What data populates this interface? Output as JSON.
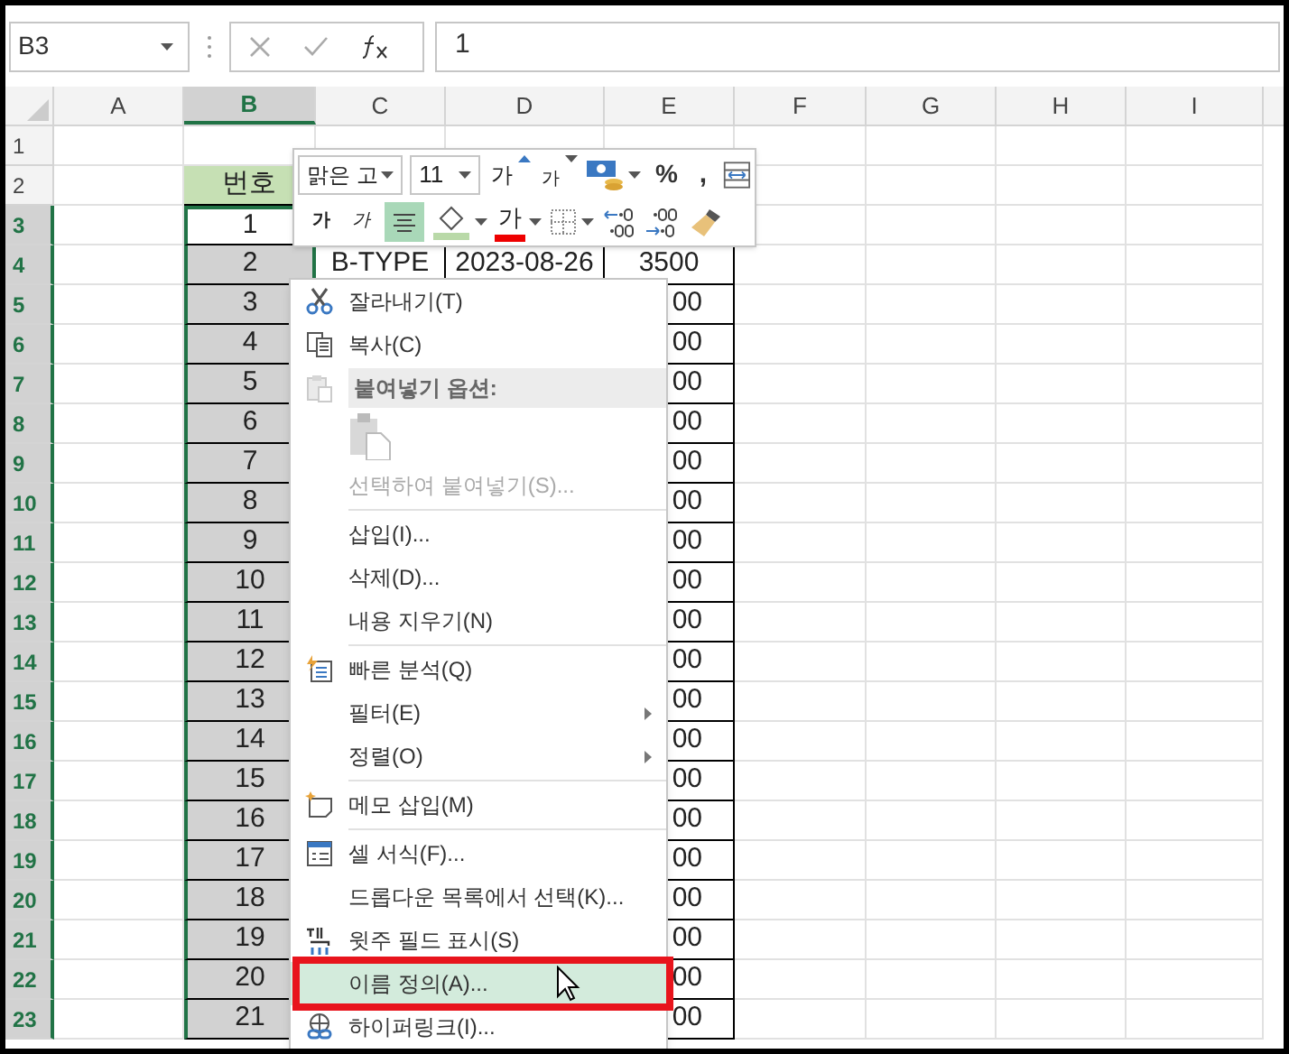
{
  "name_box": {
    "value": "B3"
  },
  "formula_bar": {
    "value": "1"
  },
  "columns": [
    {
      "label": "A",
      "selected": false
    },
    {
      "label": "B",
      "selected": true
    },
    {
      "label": "C",
      "selected": false
    },
    {
      "label": "D",
      "selected": false
    },
    {
      "label": "E",
      "selected": false
    },
    {
      "label": "F",
      "selected": false
    },
    {
      "label": "G",
      "selected": false
    },
    {
      "label": "H",
      "selected": false
    },
    {
      "label": "I",
      "selected": false
    }
  ],
  "rows": [
    {
      "label": "1",
      "selected": false,
      "active": false,
      "kind": "plain",
      "cells": {}
    },
    {
      "label": "2",
      "selected": false,
      "active": false,
      "kind": "header",
      "cells": {
        "B": "번호"
      }
    },
    {
      "label": "3",
      "selected": true,
      "active": true,
      "kind": "data",
      "cells": {
        "B": "1"
      }
    },
    {
      "label": "4",
      "selected": true,
      "active": false,
      "kind": "data",
      "cells": {
        "B": "2",
        "C": "B-TYPE",
        "D": "2023-08-26",
        "E": "3500"
      }
    },
    {
      "label": "5",
      "selected": true,
      "active": false,
      "kind": "data",
      "cells": {
        "B": "3",
        "E": "00"
      }
    },
    {
      "label": "6",
      "selected": true,
      "active": false,
      "kind": "data",
      "cells": {
        "B": "4",
        "E": "00"
      }
    },
    {
      "label": "7",
      "selected": true,
      "active": false,
      "kind": "data",
      "cells": {
        "B": "5",
        "E": "00"
      }
    },
    {
      "label": "8",
      "selected": true,
      "active": false,
      "kind": "data",
      "cells": {
        "B": "6",
        "E": "00"
      }
    },
    {
      "label": "9",
      "selected": true,
      "active": false,
      "kind": "data",
      "cells": {
        "B": "7",
        "E": "00"
      }
    },
    {
      "label": "10",
      "selected": true,
      "active": false,
      "kind": "data",
      "cells": {
        "B": "8",
        "E": "00"
      }
    },
    {
      "label": "11",
      "selected": true,
      "active": false,
      "kind": "data",
      "cells": {
        "B": "9",
        "E": "00"
      }
    },
    {
      "label": "12",
      "selected": true,
      "active": false,
      "kind": "data",
      "cells": {
        "B": "10",
        "E": "00"
      }
    },
    {
      "label": "13",
      "selected": true,
      "active": false,
      "kind": "data",
      "cells": {
        "B": "11",
        "E": "00"
      }
    },
    {
      "label": "14",
      "selected": true,
      "active": false,
      "kind": "data",
      "cells": {
        "B": "12",
        "E": "00"
      }
    },
    {
      "label": "15",
      "selected": true,
      "active": false,
      "kind": "data",
      "cells": {
        "B": "13",
        "E": "00"
      }
    },
    {
      "label": "16",
      "selected": true,
      "active": false,
      "kind": "data",
      "cells": {
        "B": "14",
        "E": "00"
      }
    },
    {
      "label": "17",
      "selected": true,
      "active": false,
      "kind": "data",
      "cells": {
        "B": "15",
        "E": "00"
      }
    },
    {
      "label": "18",
      "selected": true,
      "active": false,
      "kind": "data",
      "cells": {
        "B": "16",
        "E": "00"
      }
    },
    {
      "label": "19",
      "selected": true,
      "active": false,
      "kind": "data",
      "cells": {
        "B": "17",
        "E": "00"
      }
    },
    {
      "label": "20",
      "selected": true,
      "active": false,
      "kind": "data",
      "cells": {
        "B": "18",
        "E": "00"
      }
    },
    {
      "label": "21",
      "selected": true,
      "active": false,
      "kind": "data",
      "cells": {
        "B": "19",
        "E": "00"
      }
    },
    {
      "label": "22",
      "selected": true,
      "active": false,
      "kind": "data",
      "cells": {
        "B": "20",
        "E": "00"
      }
    },
    {
      "label": "23",
      "selected": true,
      "active": false,
      "kind": "data",
      "cells": {
        "B": "21",
        "E": "00"
      }
    }
  ],
  "mini_toolbar": {
    "row_1": [
      {
        "kind": "font",
        "text": "맑은 고"
      },
      {
        "kind": "size",
        "text": "11"
      },
      {
        "kind": "grow",
        "text": "가"
      },
      {
        "kind": "shrink",
        "text": "가"
      },
      {
        "kind": "accounting"
      },
      {
        "kind": "percent",
        "text": "%"
      },
      {
        "kind": "comma",
        "text": ","
      },
      {
        "kind": "wrap"
      }
    ],
    "row_2": [
      {
        "kind": "bold",
        "text": "가",
        "selected": false
      },
      {
        "kind": "italic",
        "text": "가",
        "selected": false
      },
      {
        "kind": "align",
        "selected": true
      },
      {
        "kind": "fill",
        "selected": false
      },
      {
        "kind": "font_color",
        "text": "가",
        "selected": false
      },
      {
        "kind": "borders",
        "selected": false
      },
      {
        "kind": "decrease_decimal",
        "selected": false
      },
      {
        "kind": "increase_decimal",
        "selected": false
      },
      {
        "kind": "painter",
        "selected": false
      }
    ]
  },
  "context_menu": [
    {
      "kind": "item",
      "label": "잘라내기(T)",
      "disabled": false,
      "submenu": false,
      "selected": false,
      "outlined": false
    },
    {
      "kind": "item",
      "label": "복사(C)",
      "disabled": false,
      "submenu": false,
      "selected": false,
      "outlined": false
    },
    {
      "kind": "header",
      "label": "붙여넣기 옵션:"
    },
    {
      "kind": "paste_option"
    },
    {
      "kind": "item",
      "label": "선택하여 붙여넣기(S)...",
      "disabled": true,
      "submenu": false,
      "selected": false,
      "outlined": false
    },
    {
      "kind": "separator"
    },
    {
      "kind": "item",
      "label": "삽입(I)...",
      "disabled": false,
      "submenu": false,
      "selected": false,
      "outlined": false
    },
    {
      "kind": "item",
      "label": "삭제(D)...",
      "disabled": false,
      "submenu": false,
      "selected": false,
      "outlined": false
    },
    {
      "kind": "item",
      "label": "내용 지우기(N)",
      "disabled": false,
      "submenu": false,
      "selected": false,
      "outlined": false
    },
    {
      "kind": "separator"
    },
    {
      "kind": "item",
      "label": "빠른 분석(Q)",
      "disabled": false,
      "submenu": false,
      "selected": false,
      "outlined": false
    },
    {
      "kind": "item",
      "label": "필터(E)",
      "disabled": false,
      "submenu": true,
      "selected": false,
      "outlined": false
    },
    {
      "kind": "item",
      "label": "정렬(O)",
      "disabled": false,
      "submenu": true,
      "selected": false,
      "outlined": false
    },
    {
      "kind": "separator"
    },
    {
      "kind": "item",
      "label": "메모 삽입(M)",
      "disabled": false,
      "submenu": false,
      "selected": false,
      "outlined": false
    },
    {
      "kind": "separator"
    },
    {
      "kind": "item",
      "label": "셀 서식(F)...",
      "disabled": false,
      "submenu": false,
      "selected": false,
      "outlined": false
    },
    {
      "kind": "item",
      "label": "드롭다운 목록에서 선택(K)...",
      "disabled": false,
      "submenu": false,
      "selected": false,
      "outlined": false
    },
    {
      "kind": "item",
      "label": "윗주 필드 표시(S)",
      "disabled": false,
      "submenu": false,
      "selected": false,
      "outlined": false
    },
    {
      "kind": "item",
      "label": "이름 정의(A)...",
      "disabled": false,
      "submenu": false,
      "selected": true,
      "outlined": true
    },
    {
      "kind": "item",
      "label": "하이퍼링크(I)...",
      "disabled": false,
      "submenu": false,
      "selected": false,
      "outlined": false
    }
  ]
}
